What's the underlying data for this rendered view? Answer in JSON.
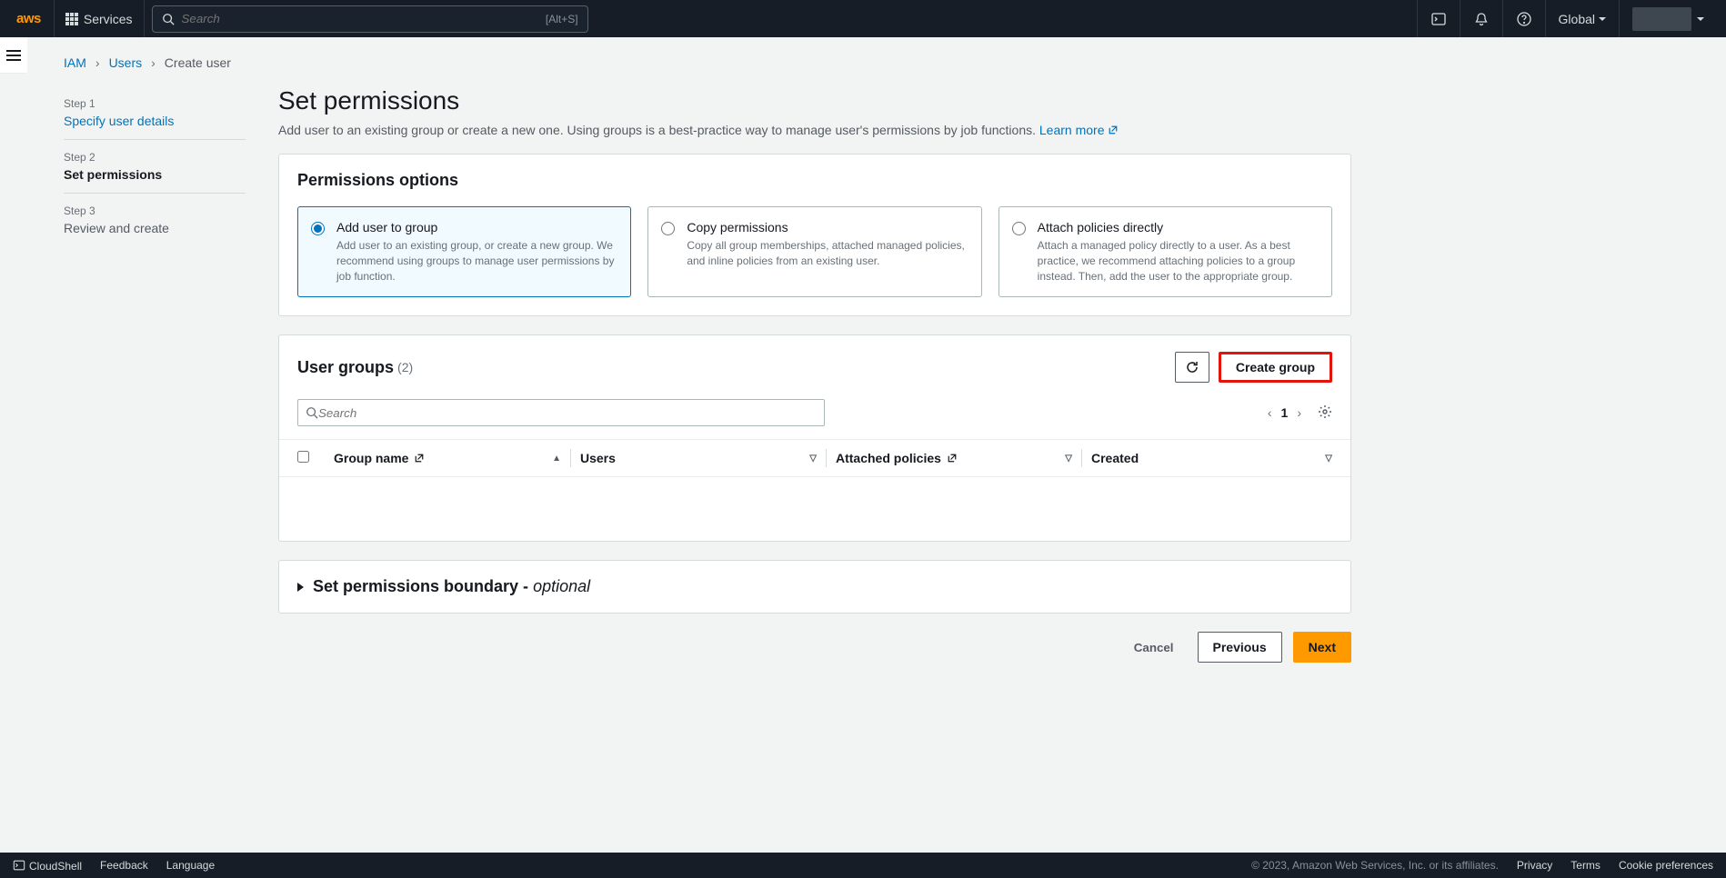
{
  "topnav": {
    "logo": "aws",
    "services": "Services",
    "search_placeholder": "Search",
    "search_shortcut": "[Alt+S]",
    "region": "Global"
  },
  "breadcrumbs": {
    "iam": "IAM",
    "users": "Users",
    "create_user": "Create user"
  },
  "steps": [
    {
      "num": "Step 1",
      "label": "Specify user details",
      "state": "link"
    },
    {
      "num": "Step 2",
      "label": "Set permissions",
      "state": "active"
    },
    {
      "num": "Step 3",
      "label": "Review and create",
      "state": "future"
    }
  ],
  "heading": "Set permissions",
  "subtitle": "Add user to an existing group or create a new one. Using groups is a best-practice way to manage user's permissions by job functions.",
  "learn_more": "Learn more",
  "perm_options_title": "Permissions options",
  "options": [
    {
      "title": "Add user to group",
      "desc": "Add user to an existing group, or create a new group. We recommend using groups to manage user permissions by job function.",
      "selected": true
    },
    {
      "title": "Copy permissions",
      "desc": "Copy all group memberships, attached managed policies, and inline policies from an existing user.",
      "selected": false
    },
    {
      "title": "Attach policies directly",
      "desc": "Attach a managed policy directly to a user. As a best practice, we recommend attaching policies to a group instead. Then, add the user to the appropriate group.",
      "selected": false
    }
  ],
  "user_groups": {
    "title": "User groups",
    "count": "(2)",
    "create_group": "Create group",
    "filter_placeholder": "Search",
    "page": "1",
    "columns": {
      "name": "Group name",
      "users": "Users",
      "policies": "Attached policies",
      "created": "Created"
    }
  },
  "boundary": {
    "label": "Set permissions boundary - ",
    "optional": "optional"
  },
  "actions": {
    "cancel": "Cancel",
    "previous": "Previous",
    "next": "Next"
  },
  "footer": {
    "cloudshell": "CloudShell",
    "feedback": "Feedback",
    "language": "Language",
    "copyright": "© 2023, Amazon Web Services, Inc. or its affiliates.",
    "privacy": "Privacy",
    "terms": "Terms",
    "cookies": "Cookie preferences"
  }
}
